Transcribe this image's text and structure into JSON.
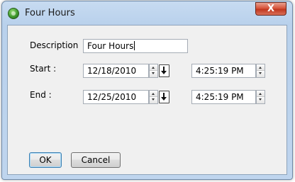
{
  "window": {
    "title": "Four Hours",
    "app_icon": "green-globe-icon",
    "close_label": "X"
  },
  "form": {
    "description_label": "Description",
    "description_value": "Four Hours",
    "start_label": "Start :",
    "start_date": "12/18/2010",
    "start_time": "4:25:19 PM",
    "end_label": "End :",
    "end_date": "12/25/2010",
    "end_time": "4:25:19 PM"
  },
  "buttons": {
    "ok_label": "OK",
    "cancel_label": "Cancel"
  },
  "icons": {
    "spinner": "up-down-spinner-icon",
    "calendar": "dropdown-arrow-icon"
  }
}
